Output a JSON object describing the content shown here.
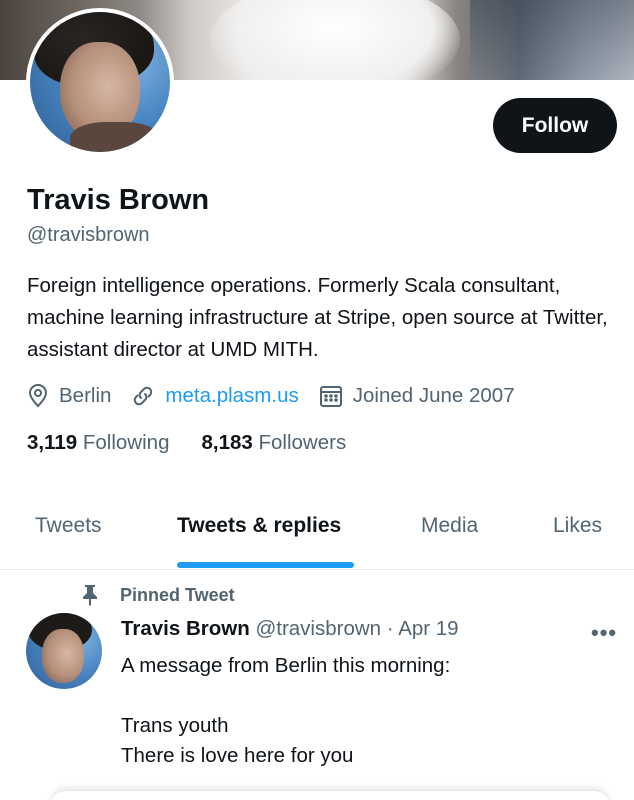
{
  "profile": {
    "name": "Travis Brown",
    "handle": "@travisbrown",
    "bio": "Foreign intelligence operations. Formerly Scala consultant, machine learning infrastructure at Stripe, open source at Twitter, assistant director at UMD MITH.",
    "location": "Berlin",
    "website": "meta.plasm.us",
    "joined": "Joined June 2007",
    "following_count": "3,119",
    "following_label": "Following",
    "followers_count": "8,183",
    "followers_label": "Followers"
  },
  "actions": {
    "follow_label": "Follow"
  },
  "tabs": [
    {
      "label": "Tweets",
      "active": false
    },
    {
      "label": "Tweets & replies",
      "active": true
    },
    {
      "label": "Media",
      "active": false
    },
    {
      "label": "Likes",
      "active": false
    }
  ],
  "pinned_tweet": {
    "pinned_label": "Pinned Tweet",
    "author_name": "Travis Brown",
    "author_handle": "@travisbrown",
    "separator": "·",
    "date": "Apr 19",
    "more_label": "•••",
    "lines": [
      "A message from Berlin this morning:",
      "",
      "Trans youth",
      "There is love here for you"
    ]
  },
  "icons": {
    "location": "location-pin-icon",
    "link": "link-icon",
    "calendar": "calendar-icon",
    "pin": "pin-icon",
    "more": "more-icon"
  },
  "colors": {
    "accent": "#1d9bf0",
    "text_primary": "#0f1419",
    "text_secondary": "#536471",
    "button_bg": "#0f1419"
  }
}
